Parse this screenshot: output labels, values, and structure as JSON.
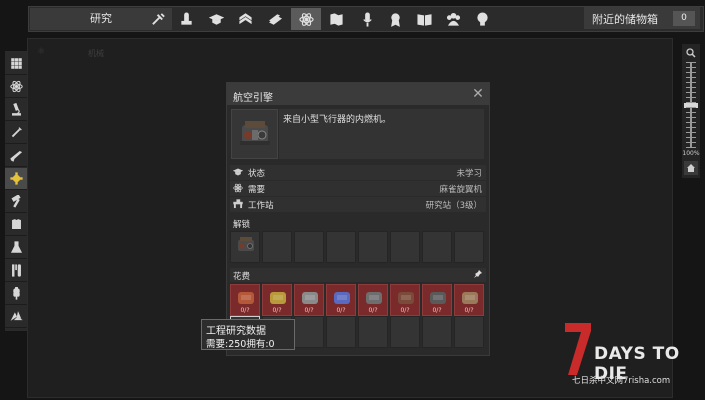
{
  "toolbar": {
    "title": "研究",
    "icons": [
      "tools-icon",
      "crafting-icon",
      "graduation-cap-icon",
      "rank-chevrons-icon",
      "book-stack-icon",
      "atom-icon",
      "map-icon",
      "microphone-icon",
      "medal-icon",
      "open-book-icon",
      "group-icon",
      "lightbulb-icon"
    ],
    "active_icon": "atom-icon",
    "storage_label": "附近的储物箱",
    "storage_count": "0"
  },
  "sidebar": {
    "items": [
      "grid-icon",
      "atom-icon",
      "microscope-icon",
      "syringe-icon",
      "rifle-icon",
      "engine-icon",
      "hammer-icon",
      "armor-icon",
      "flask-icon",
      "utensils-icon",
      "wheat-icon",
      "recycle-icon"
    ],
    "active_item": "engine-icon"
  },
  "background": {
    "ghost_label": "机械"
  },
  "zoom": {
    "percent": "100%",
    "level": 0.5
  },
  "dialog": {
    "title": "航空引擎",
    "description": "来自小型飞行器的内燃机。",
    "props": [
      {
        "icon": "graduation-cap-icon",
        "label": "状态",
        "value": "未学习"
      },
      {
        "icon": "atom-icon",
        "label": "需要",
        "value": "麻雀旋翼机"
      },
      {
        "icon": "workbench-icon",
        "label": "工作站",
        "value": "研究站（3级）"
      }
    ],
    "unlock_label": "解锁",
    "cost_label": "花费",
    "cost_items": [
      {
        "name": "wires-item",
        "count": "0/?"
      },
      {
        "name": "brass-item",
        "count": "0/?"
      },
      {
        "name": "plate-item",
        "count": "0/?"
      },
      {
        "name": "chemicals-item",
        "count": "0/?"
      },
      {
        "name": "springs-item",
        "count": "0/?"
      },
      {
        "name": "gear-item",
        "count": "0/?"
      },
      {
        "name": "engine-part-item",
        "count": "0/?"
      },
      {
        "name": "scrap-item",
        "count": "0/?"
      },
      {
        "name": "research-data-item",
        "count": "0/250"
      }
    ]
  },
  "tooltip": {
    "title": "工程研究数据",
    "detail": "需要:250拥有:0"
  },
  "logo": {
    "numeral": "7",
    "text": "DAYS TO DIE",
    "sub": "七日杀中文网7risha.com"
  },
  "colors": {
    "accent": "#e4c23a",
    "cost_red": "#7a2a2a",
    "brand_red": "#c92a2a"
  }
}
